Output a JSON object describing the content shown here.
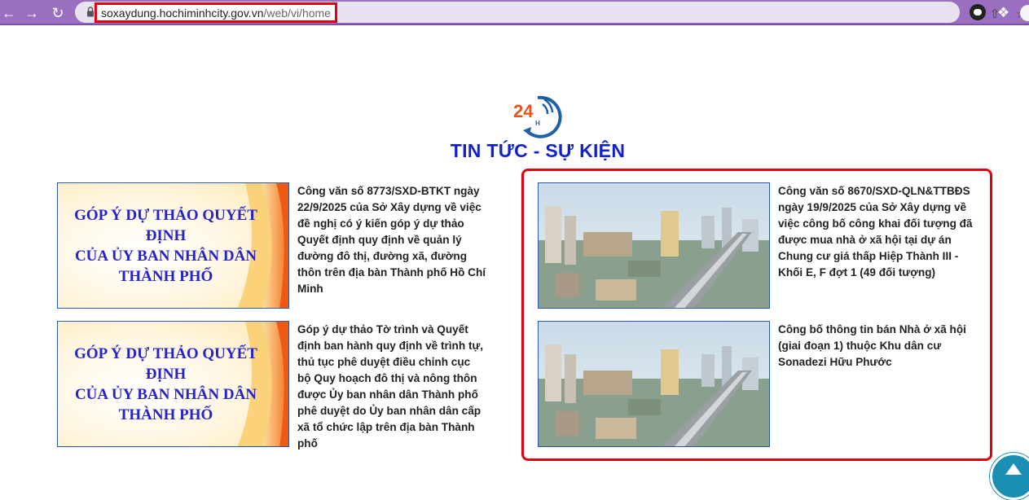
{
  "browser": {
    "url_host": "soxaydung.hochiminhcity.gov.vn",
    "url_path": "/web/vi/home",
    "icons": [
      "back-icon",
      "forward-icon",
      "reload-icon",
      "lock-icon",
      "share-icon",
      "star-icon",
      "extension-icon",
      "puzzle-icon"
    ]
  },
  "header": {
    "logo_text": "24",
    "logo_sub": "H",
    "title": "TIN TỨC - SỰ KIỆN"
  },
  "thumbnail_banner": {
    "line1": "GÓP Ý DỰ THẢO QUYẾT ĐỊNH",
    "line2": "CỦA ỦY BAN NHÂN DÂN",
    "line3": "THÀNH PHỐ"
  },
  "news": [
    {
      "title": "Công văn số 8773/SXD-BTKT ngày 22/9/2025 của Sở Xây dựng về việc đề nghị có ý kiến góp ý dự thảo Quyết định quy định về quản lý đường đô thị, đường xã, đường thôn trên địa bàn Thành phố Hồ Chí Minh",
      "image": "banner"
    },
    {
      "title": "Góp ý dự thảo Tờ trình và Quyết định ban hành quy định về trình tự, thủ tục phê duyệt điều chỉnh cục bộ Quy hoạch đô thị và nông thôn được Ủy ban nhân dân Thành phố phê duyệt do Ủy ban nhân dân cấp xã tổ chức lập trên địa bàn Thành phố",
      "image": "banner"
    },
    {
      "title": "Công văn số 8670/SXD-QLN&TTBĐS ngày 19/9/2025 của Sở Xây dựng về việc công bố công khai đối tượng đã được mua nhà ở xã hội tại dự án Chung cư giá thấp Hiệp Thành III - Khối E, F đợt 1 (49 đối tượng)",
      "image": "city-photo"
    },
    {
      "title": "Công bố thông tin bán Nhà ở xã hội (giai đoạn 1) thuộc Khu dân cư Sonadezi Hữu Phước",
      "image": "city-photo"
    }
  ],
  "colors": {
    "browser_bar": "#9b6fc0",
    "title_blue": "#1122cc",
    "highlight_red": "#e3000b",
    "banner_text": "#2624c8",
    "scroll_button": "#1a8fb3"
  }
}
